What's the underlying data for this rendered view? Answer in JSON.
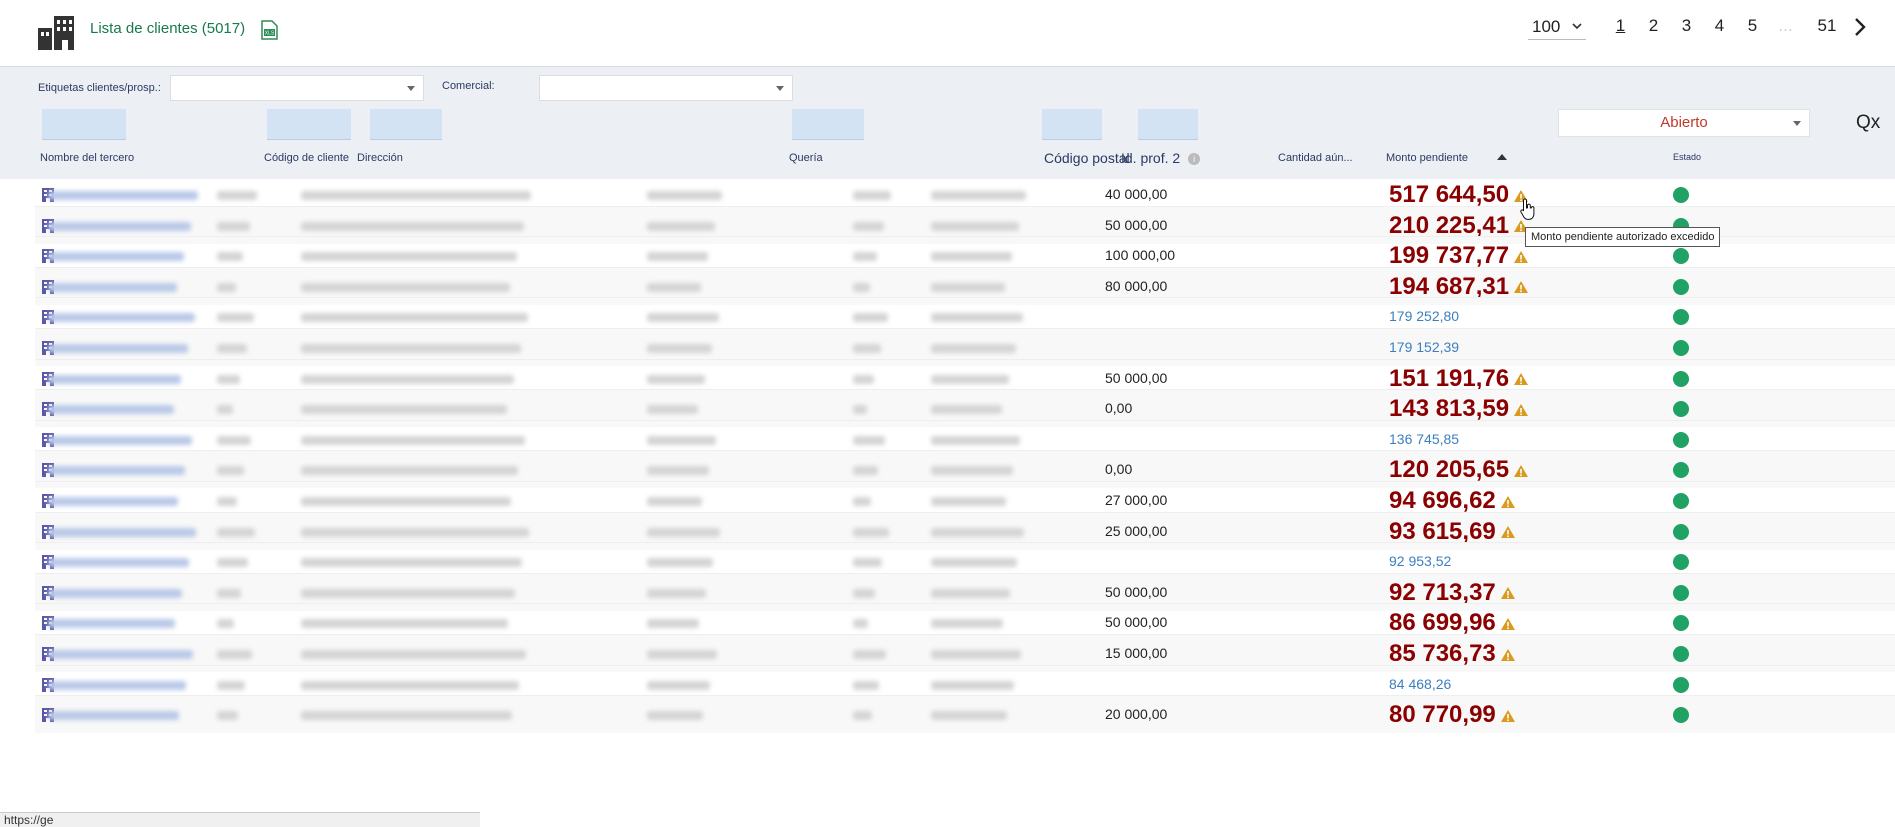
{
  "header": {
    "title": "Lista de clientes (5017)",
    "per_page": "100",
    "pages": [
      "1",
      "2",
      "3",
      "4",
      "5",
      "...",
      "51"
    ]
  },
  "filters": {
    "tags_label": "Etiquetas clientes/prosp.:",
    "sales_label": "Comercial:",
    "status_value": "Abierto",
    "qx_label": "Qx"
  },
  "columns": {
    "name": "Nombre del tercero",
    "code": "Código de cliente",
    "address": "Dirección",
    "town": "Quería",
    "zip": "Código postal",
    "prof2": "Id. prof. 2",
    "qty": "Cantidad aún...",
    "amount": "Monto pendiente",
    "status": "Estado"
  },
  "rows": [
    {
      "qty": "40 000,00",
      "amount": "517 644,50",
      "warn": true
    },
    {
      "qty": "50 000,00",
      "amount": "210 225,41",
      "warn": true
    },
    {
      "qty": "100 000,00",
      "amount": "199 737,77",
      "warn": true
    },
    {
      "qty": "80 000,00",
      "amount": "194 687,31",
      "warn": true
    },
    {
      "qty": "",
      "amount": "179 252,80",
      "warn": false
    },
    {
      "qty": "",
      "amount": "179 152,39",
      "warn": false
    },
    {
      "qty": "50 000,00",
      "amount": "151 191,76",
      "warn": true
    },
    {
      "qty": "0,00",
      "amount": "143 813,59",
      "warn": true
    },
    {
      "qty": "",
      "amount": "136 745,85",
      "warn": false
    },
    {
      "qty": "0,00",
      "amount": "120 205,65",
      "warn": true
    },
    {
      "qty": "27 000,00",
      "amount": "94 696,62",
      "warn": true
    },
    {
      "qty": "25 000,00",
      "amount": "93 615,69",
      "warn": true
    },
    {
      "qty": "",
      "amount": "92 953,52",
      "warn": false
    },
    {
      "qty": "50 000,00",
      "amount": "92 713,37",
      "warn": true
    },
    {
      "qty": "50 000,00",
      "amount": "86 699,96",
      "warn": true
    },
    {
      "qty": "15 000,00",
      "amount": "85 736,73",
      "warn": true
    },
    {
      "qty": "",
      "amount": "84 468,26",
      "warn": false
    },
    {
      "qty": "20 000,00",
      "amount": "80 770,99",
      "warn": true
    }
  ],
  "tooltip": "Monto pendiente autorizado excedido",
  "statusbar": "https://ge",
  "colors": {
    "accent": "#18794e",
    "danger": "#8b0000",
    "link": "#3c7fbf",
    "status_ok": "#1fa263"
  }
}
